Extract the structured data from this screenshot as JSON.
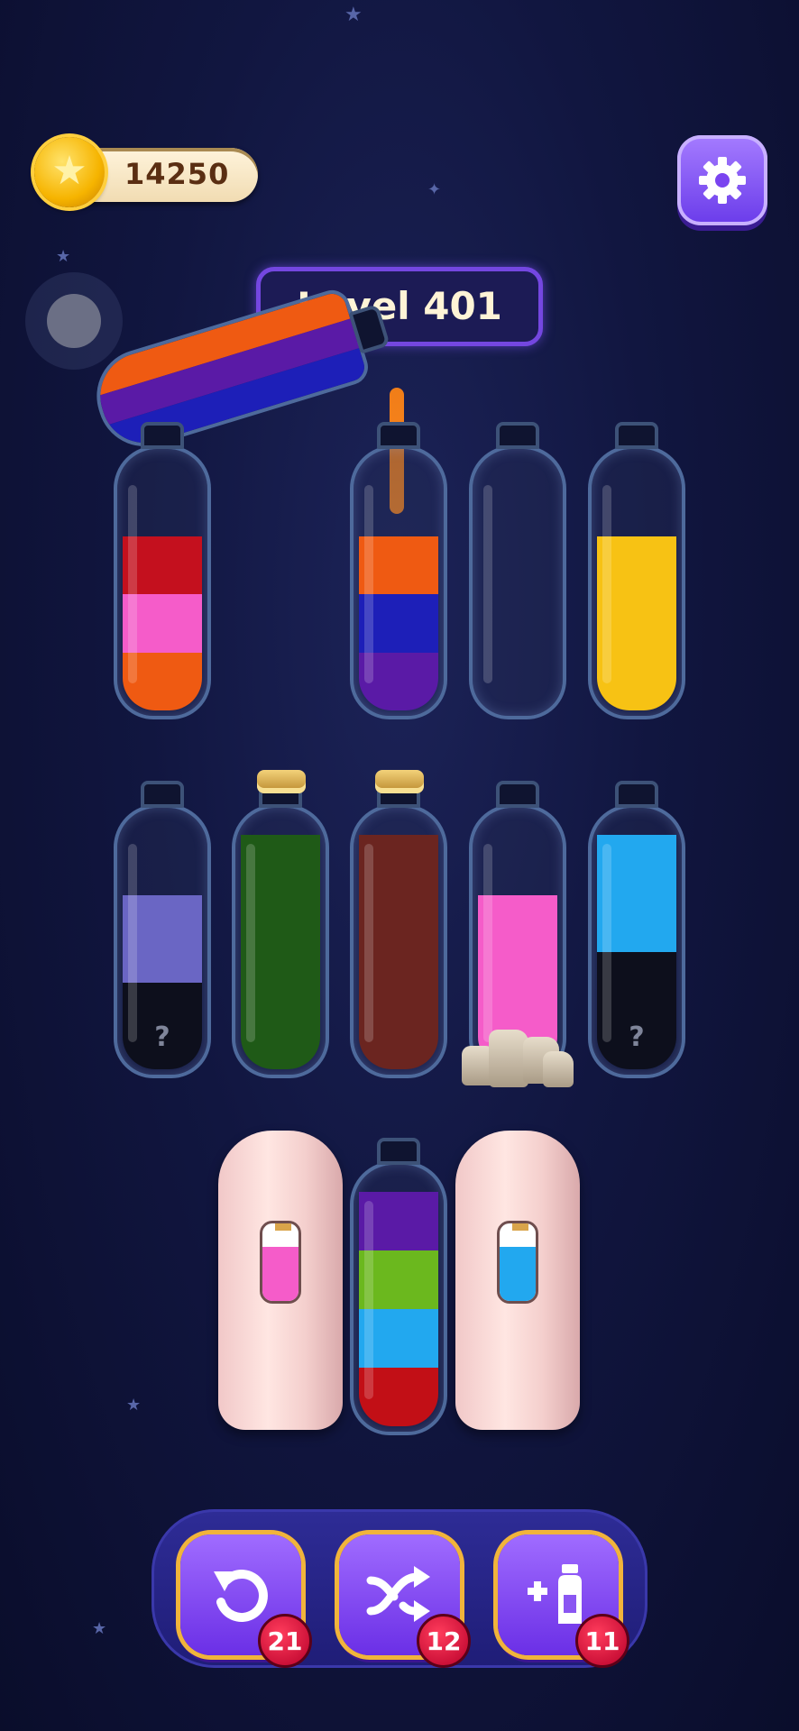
{
  "hud": {
    "coins": "14250",
    "coin_icon": "star-coin-icon",
    "settings_icon": "gear-icon",
    "level_label": "Level 401"
  },
  "colors": {
    "red": "#c4101e",
    "pink": "#f55cc9",
    "orange": "#ef5a12",
    "purple": "#5a1aa6",
    "blue": "#1d1fb8",
    "yellow": "#f7c214",
    "lavender": "#6a66c4",
    "green": "#1f5a17",
    "brown": "#6b2520",
    "cyan": "#22a8ef",
    "lime": "#6bb81e",
    "dark_red": "#c20f16"
  },
  "pouring_bottle": {
    "layers_top_to_bottom": [
      "orange",
      "purple",
      "blue"
    ]
  },
  "rows": [
    {
      "bottles": [
        {
          "id": "b1",
          "layers_bottom_to_top": [
            "orange",
            "pink",
            "red"
          ],
          "fill": 0.66
        },
        {
          "id": "b2",
          "layers_bottom_to_top": [
            "purple",
            "blue",
            "orange"
          ],
          "fill": 0.66
        },
        {
          "id": "b3",
          "layers_bottom_to_top": [],
          "fill": 0
        },
        {
          "id": "b4",
          "layers_bottom_to_top": [
            "yellow"
          ],
          "fill": 0.66
        }
      ]
    },
    {
      "bottles": [
        {
          "id": "b5",
          "layers_bottom_to_top": [
            "hidden",
            "lavender"
          ],
          "fill": 0.66,
          "mystery_mark": "?"
        },
        {
          "id": "b6",
          "layers_bottom_to_top": [
            "green"
          ],
          "fill": 0.89,
          "corked": true
        },
        {
          "id": "b7",
          "layers_bottom_to_top": [
            "brown"
          ],
          "fill": 0.89,
          "corked": true
        },
        {
          "id": "b8",
          "layers_bottom_to_top": [
            "pink"
          ],
          "fill": 0.66,
          "stones": true
        },
        {
          "id": "b9",
          "layers_bottom_to_top": [
            "hidden",
            "cyan"
          ],
          "fill": 0.89,
          "mystery_mark": "?"
        }
      ]
    },
    {
      "bottles": [
        {
          "id": "b10",
          "covered": true,
          "hint_color": "pink"
        },
        {
          "id": "b11",
          "layers_bottom_to_top": [
            "dark_red",
            "cyan",
            "lime",
            "purple"
          ],
          "fill": 0.89
        },
        {
          "id": "b12",
          "covered": true,
          "hint_color": "cyan"
        }
      ]
    }
  ],
  "toolbar": {
    "undo": {
      "icon": "undo-icon",
      "count": "21"
    },
    "shuffle": {
      "icon": "shuffle-icon",
      "count": "12"
    },
    "add_bottle": {
      "icon": "add-bottle-icon",
      "count": "11"
    }
  }
}
